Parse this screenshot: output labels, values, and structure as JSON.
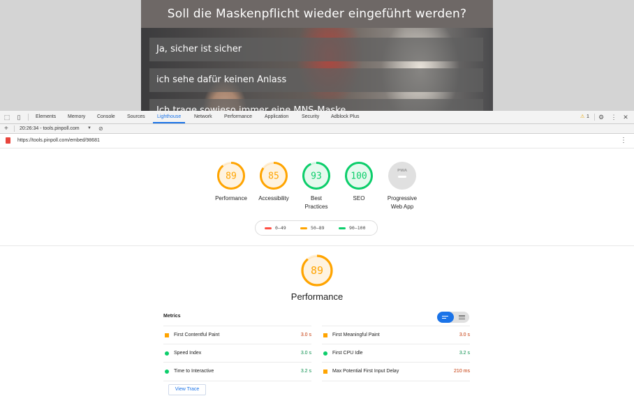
{
  "webpage": {
    "poll_question": "Soll die Maskenpflicht wieder eingeführt werden?",
    "options": [
      "Ja, sicher ist sicher",
      "ich sehe dafür keinen Anlass",
      "Ich trage sowieso immer eine MNS-Maske"
    ]
  },
  "devtools": {
    "tabs": [
      "Elements",
      "Memory",
      "Console",
      "Sources",
      "Lighthouse",
      "Network",
      "Performance",
      "Application",
      "Security",
      "Adblock Plus"
    ],
    "active_tab": "Lighthouse",
    "warning_count": "1",
    "report_selector": "20:26:34 - tools.pinpoll.com",
    "url": "https://tools.pinpoll.com/embed/98681"
  },
  "colors": {
    "pass": "#0cce6b",
    "average": "#ffa400",
    "fail": "#ff4e42",
    "accent": "#1a73e8"
  },
  "scores": [
    {
      "label": "Performance",
      "value": "89",
      "score": 89,
      "status": "average"
    },
    {
      "label": "Accessibility",
      "value": "85",
      "score": 85,
      "status": "average"
    },
    {
      "label": "Best Practices",
      "value": "93",
      "score": 93,
      "status": "pass"
    },
    {
      "label": "SEO",
      "value": "100",
      "score": 100,
      "status": "pass"
    },
    {
      "label": "Progressive Web App",
      "value": "PWA",
      "status": "na"
    }
  ],
  "legend": [
    {
      "range": "0–49",
      "status": "fail"
    },
    {
      "range": "50–89",
      "status": "average"
    },
    {
      "range": "90–100",
      "status": "pass"
    }
  ],
  "performance": {
    "score": "89",
    "score_value": 89,
    "title": "Performance",
    "metrics_title": "Metrics",
    "metrics_left": [
      {
        "name": "First Contentful Paint",
        "value": "3.0 s",
        "status": "average"
      },
      {
        "name": "Speed Index",
        "value": "3.0 s",
        "status": "pass"
      },
      {
        "name": "Time to Interactive",
        "value": "3.2 s",
        "status": "pass"
      }
    ],
    "metrics_right": [
      {
        "name": "First Meaningful Paint",
        "value": "3.0 s",
        "status": "average"
      },
      {
        "name": "First CPU Idle",
        "value": "3.2 s",
        "status": "pass"
      },
      {
        "name": "Max Potential First Input Delay",
        "value": "210 ms",
        "status": "average"
      }
    ],
    "view_trace_label": "View Trace"
  }
}
